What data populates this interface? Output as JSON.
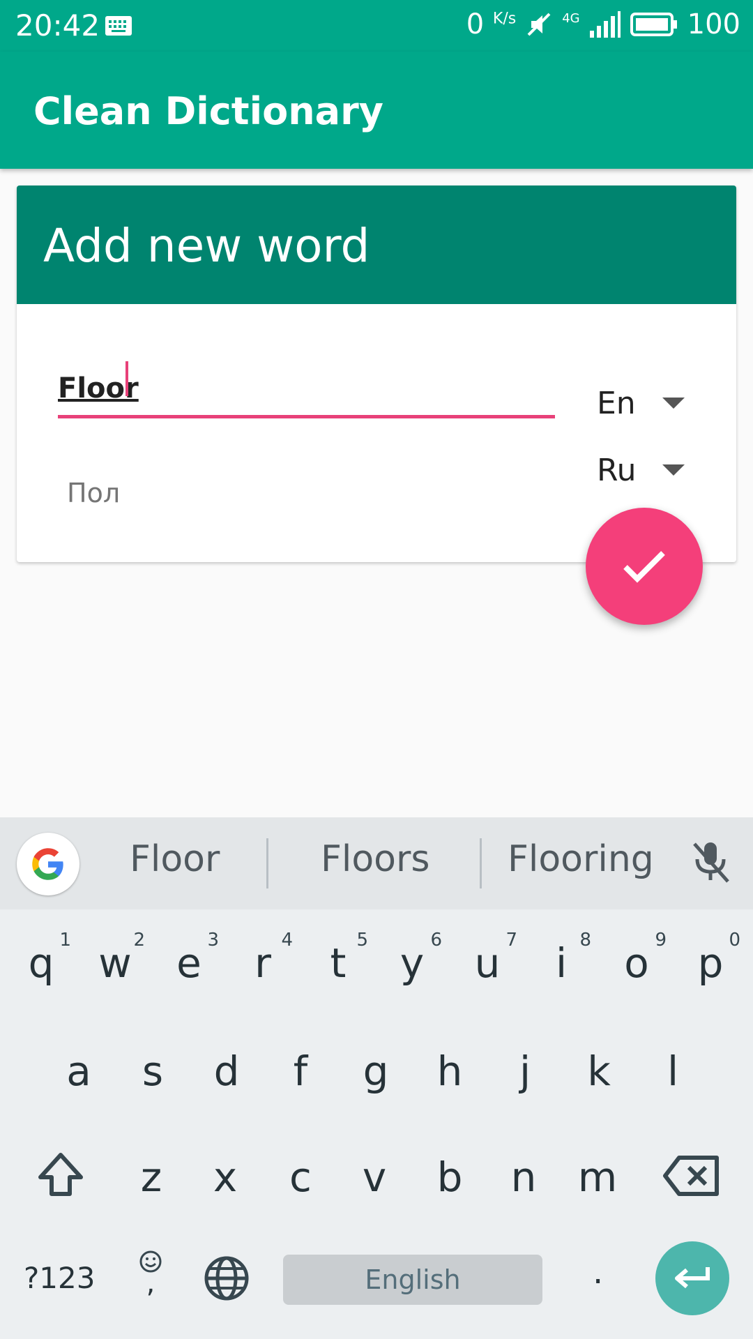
{
  "status_bar": {
    "time": "20:42",
    "net_speed": "0",
    "net_unit": "K/s",
    "battery": "100",
    "network": "4G"
  },
  "app_bar": {
    "title": "Clean Dictionary"
  },
  "dialog": {
    "title": "Add new word",
    "word_value": "Floor",
    "translation_value": "Пол",
    "source_lang": "En",
    "target_lang": "Ru",
    "confirm_icon": "check-icon"
  },
  "keyboard": {
    "suggestions": [
      "Floor",
      "Floors",
      "Flooring"
    ],
    "row1": [
      "q",
      "w",
      "e",
      "r",
      "t",
      "y",
      "u",
      "i",
      "o",
      "p"
    ],
    "row1_hints": [
      "1",
      "2",
      "3",
      "4",
      "5",
      "6",
      "7",
      "8",
      "9",
      "0"
    ],
    "row2": [
      "a",
      "s",
      "d",
      "f",
      "g",
      "h",
      "j",
      "k",
      "l"
    ],
    "row3": [
      "z",
      "x",
      "c",
      "v",
      "b",
      "n",
      "m"
    ],
    "symbols_label": "?123",
    "comma_label": ",",
    "space_label": "English",
    "period_label": "."
  },
  "colors": {
    "primary": "#00a88a",
    "primary_dark": "#00846f",
    "accent": "#f43f7a"
  }
}
